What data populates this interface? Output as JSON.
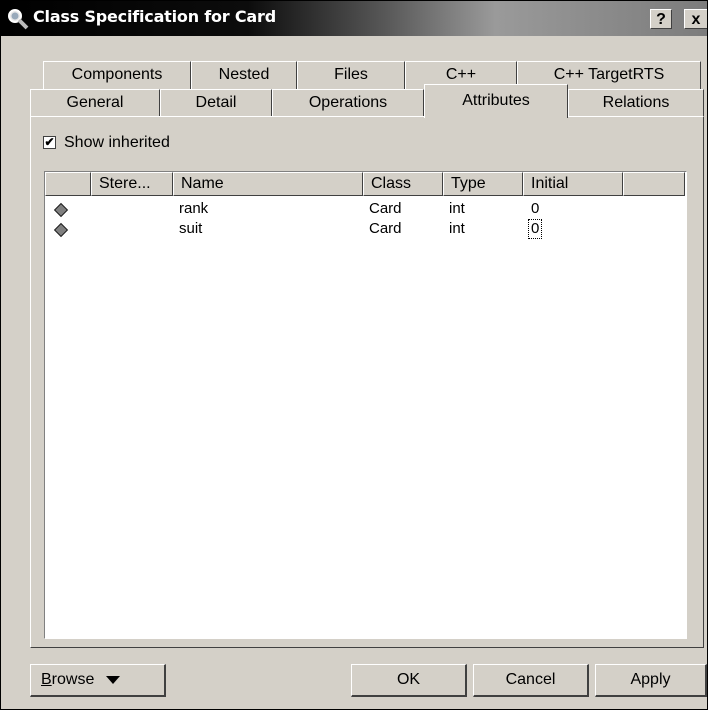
{
  "window": {
    "title": "Class Specification for Card"
  },
  "titlebar": {
    "help_label": "?",
    "close_label": "x"
  },
  "tabs": {
    "back_row": [
      "Components",
      "Nested",
      "Files",
      "C++",
      "C++ TargetRTS"
    ],
    "front_row": [
      "General",
      "Detail",
      "Operations",
      "Attributes",
      "Relations"
    ],
    "active": "Attributes"
  },
  "show_inherited": {
    "label": "Show inherited",
    "checked": true
  },
  "table": {
    "columns": [
      "",
      "Stere...",
      "Name",
      "Class",
      "Type",
      "Initial",
      ""
    ],
    "rows": [
      {
        "icon": "attribute-icon",
        "stereotype": "",
        "name": "rank",
        "class": "Card",
        "type": "int",
        "initial": "0"
      },
      {
        "icon": "attribute-icon",
        "stereotype": "",
        "name": "suit",
        "class": "Card",
        "type": "int",
        "initial": "0"
      }
    ]
  },
  "buttons": {
    "browse": "Browse",
    "browse_accel": "B",
    "ok": "OK",
    "cancel": "Cancel",
    "apply": "Apply"
  }
}
